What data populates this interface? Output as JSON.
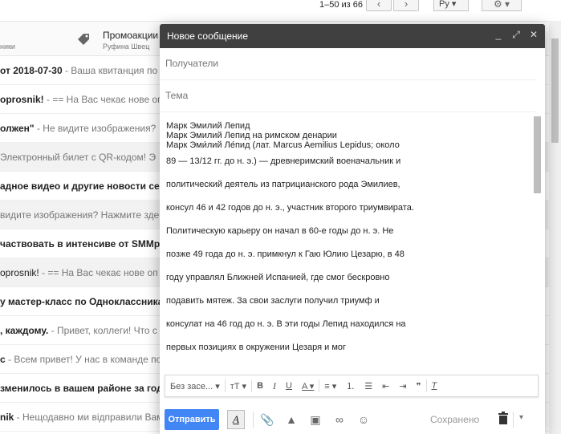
{
  "topbar": {
    "pager": "1–50 из 66",
    "prev_icon": "chevron-left-icon",
    "next_icon": "chevron-right-icon",
    "lang": "Ру",
    "settings_icon": "gear-icon"
  },
  "tabs": {
    "left_sub": "ники",
    "promo_title": "Промоакции",
    "promo_sub": "Руфина Швец"
  },
  "rows": [
    {
      "subject": "от 2018-07-30",
      "snippet": " - Ваша квитанция по",
      "unread": true
    },
    {
      "subject": "oprosnik!",
      "snippet": " - == На Вас чекає нове оп",
      "unread": true
    },
    {
      "subject": "олжен\"",
      "snippet": " - Не видите изображения?",
      "unread": true
    },
    {
      "subject": "",
      "snippet": "Электронный билет с QR-кодом! Э",
      "unread": false
    },
    {
      "subject": "адное видео и другие новости сер",
      "snippet": "",
      "unread": true
    },
    {
      "subject": "",
      "snippet": "видите изображения? Нажмите зде",
      "unread": false
    },
    {
      "subject": "частвовать в интенсиве от SMMp",
      "snippet": "",
      "unread": true
    },
    {
      "subject": "oprosnik!",
      "snippet": " - == На Вас чекає нове оп",
      "unread": false
    },
    {
      "subject": "у мастер-класс по Одноклассника",
      "snippet": "",
      "unread": true
    },
    {
      "subject": ", каждому.",
      "snippet": " - Привет, коллеги! Что с",
      "unread": true
    },
    {
      "subject": "с",
      "snippet": " - Всем привет! У нас в команде по",
      "unread": true
    },
    {
      "subject": "зменилось в вашем районе за год",
      "snippet": "",
      "unread": true
    },
    {
      "subject": "nik",
      "snippet": " - Нещодавно ми відправили Вам",
      "unread": true
    }
  ],
  "compose": {
    "title": "Новое сообщение",
    "recipients_placeholder": "Получатели",
    "subject_placeholder": "Тема",
    "body_tight": [
      "Марк Эмилий Лепид",
      "Марк Эмилий Лепид на римском денарии",
      "Марк Эми́лий Ле́пид (лат. Marcus Aemilius Lepidus; около"
    ],
    "body_loose": [
      "89 — 13/12 гг. до н. э.) — древнеримский военачальник и",
      "политический деятель из патрицианского рода Эмилиев,",
      "консул 46 и 42 годов до н. э., участник второго триумвирата.",
      "Политическую карьеру он начал в 60-е годы до н. э. Не",
      "позже 49 года до н. э. примкнул к Гаю Юлию Цезарю, в 48",
      "году управлял Ближней Испанией, где смог бескровно",
      "подавить мятеж. За свои заслуги получил триумф и",
      "консулат на 46 год до н. э. В эти годы Лепид находился на",
      "первых позициях в окружении Цезаря и мог"
    ],
    "font_select": "Без засе...",
    "size_label": "тТ",
    "bold_label": "B",
    "italic_label": "I",
    "underline_label": "U",
    "color_label": "A",
    "send_label": "Отправить",
    "format_toggle_label": "A",
    "saved_label": "Сохранено"
  }
}
